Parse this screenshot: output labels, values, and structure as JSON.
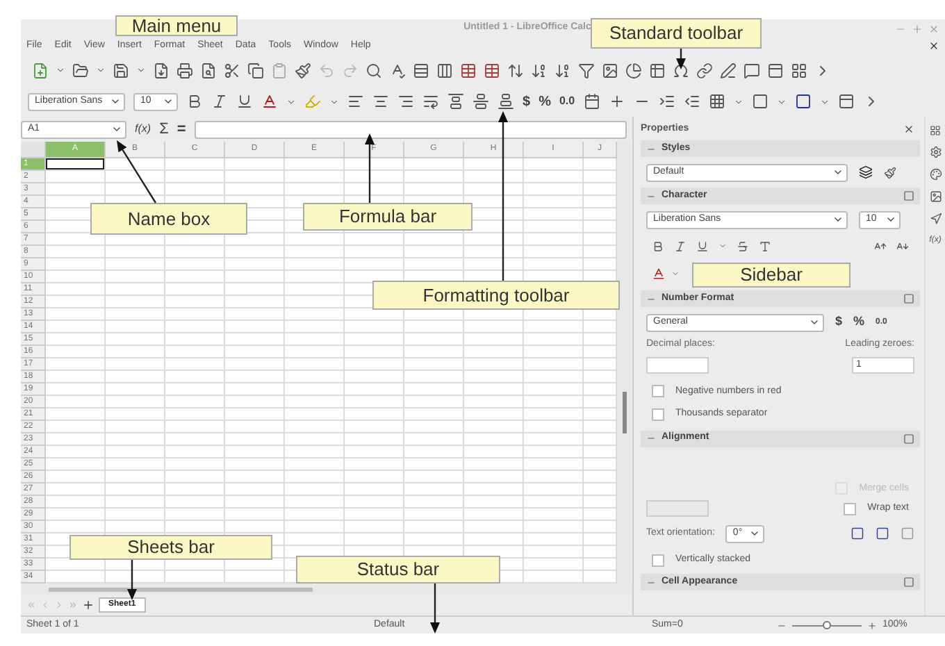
{
  "window": {
    "title": "Untitled 1 - LibreOffice Calc"
  },
  "menu": [
    "File",
    "Edit",
    "View",
    "Insert",
    "Format",
    "Sheet",
    "Data",
    "Tools",
    "Window",
    "Help"
  ],
  "formatting_toolbar": {
    "font_name": "Liberation Sans",
    "font_size": "10",
    "currency": "$",
    "percent": "%",
    "number": "0.0"
  },
  "formula_bar": {
    "name_box": "A1",
    "function_wizard": "f(x)",
    "sum": "Σ",
    "equals": "="
  },
  "columns": [
    {
      "label": "A",
      "selected": true
    },
    {
      "label": "B",
      "selected": false
    },
    {
      "label": "C",
      "selected": false
    },
    {
      "label": "D",
      "selected": false
    },
    {
      "label": "E",
      "selected": false
    },
    {
      "label": "F",
      "selected": false
    },
    {
      "label": "G",
      "selected": false
    },
    {
      "label": "H",
      "selected": false
    },
    {
      "label": "I",
      "selected": false
    },
    {
      "label": "J",
      "selected": false
    }
  ],
  "rows": [
    {
      "label": "1",
      "selected": true
    },
    {
      "label": "2",
      "selected": false
    },
    {
      "label": "3",
      "selected": false
    },
    {
      "label": "4",
      "selected": false
    },
    {
      "label": "5",
      "selected": false
    },
    {
      "label": "6",
      "selected": false
    },
    {
      "label": "7",
      "selected": false
    },
    {
      "label": "8",
      "selected": false
    },
    {
      "label": "9",
      "selected": false
    },
    {
      "label": "10",
      "selected": false
    },
    {
      "label": "11",
      "selected": false
    },
    {
      "label": "12",
      "selected": false
    },
    {
      "label": "13",
      "selected": false
    },
    {
      "label": "14",
      "selected": false
    },
    {
      "label": "15",
      "selected": false
    },
    {
      "label": "16",
      "selected": false
    },
    {
      "label": "17",
      "selected": false
    },
    {
      "label": "18",
      "selected": false
    },
    {
      "label": "19",
      "selected": false
    },
    {
      "label": "20",
      "selected": false
    },
    {
      "label": "21",
      "selected": false
    },
    {
      "label": "22",
      "selected": false
    },
    {
      "label": "23",
      "selected": false
    },
    {
      "label": "24",
      "selected": false
    },
    {
      "label": "25",
      "selected": false
    },
    {
      "label": "26",
      "selected": false
    },
    {
      "label": "27",
      "selected": false
    },
    {
      "label": "28",
      "selected": false
    },
    {
      "label": "29",
      "selected": false
    },
    {
      "label": "30",
      "selected": false
    },
    {
      "label": "31",
      "selected": false
    },
    {
      "label": "32",
      "selected": false
    },
    {
      "label": "33",
      "selected": false
    },
    {
      "label": "34",
      "selected": false
    }
  ],
  "sheet_tabs": [
    {
      "label": "Sheet1",
      "selected": true
    }
  ],
  "status_bar": {
    "sheet": "Sheet 1 of 1",
    "page_style": "Default",
    "sum": "Sum=0",
    "zoom": {
      "level": 0.5,
      "reading": "100%"
    }
  },
  "sidebar": {
    "title": "Properties",
    "styles": {
      "heading": "Styles",
      "style": "Default"
    },
    "character": {
      "heading": "Character",
      "font_name": "Liberation Sans",
      "font_size": "10"
    },
    "number_format": {
      "heading": "Number Format",
      "category": "General",
      "currency": "$",
      "percent": "%",
      "number": "0.0",
      "decimal_places_label": "Decimal places:",
      "leading_zeroes_label": "Leading zeroes:",
      "leading_zeroes": "1",
      "options": [
        {
          "label": "Negative numbers in red",
          "checked": false,
          "disabled": false
        },
        {
          "label": "Thousands separator",
          "checked": false,
          "disabled": false
        }
      ]
    },
    "alignment": {
      "heading": "Alignment",
      "merge_cells": {
        "label": "Merge cells",
        "checked": false,
        "disabled": true
      },
      "wrap_text": {
        "label": "Wrap text",
        "checked": false,
        "disabled": false
      },
      "orientation_label": "Text orientation:",
      "orientation": "0°",
      "vertically_stacked": {
        "label": "Vertically stacked",
        "checked": false,
        "disabled": false
      }
    },
    "cell_appearance": {
      "heading": "Cell Appearance"
    }
  },
  "sidebar_tabs": {
    "functions": "f(x)"
  },
  "callouts": [
    {
      "text": "Main menu"
    },
    {
      "text": "Standard toolbar"
    },
    {
      "text": "Name box"
    },
    {
      "text": "Formula bar"
    },
    {
      "text": "Formatting toolbar"
    },
    {
      "text": "Sidebar"
    },
    {
      "text": "Sheets bar"
    },
    {
      "text": "Status bar"
    }
  ]
}
